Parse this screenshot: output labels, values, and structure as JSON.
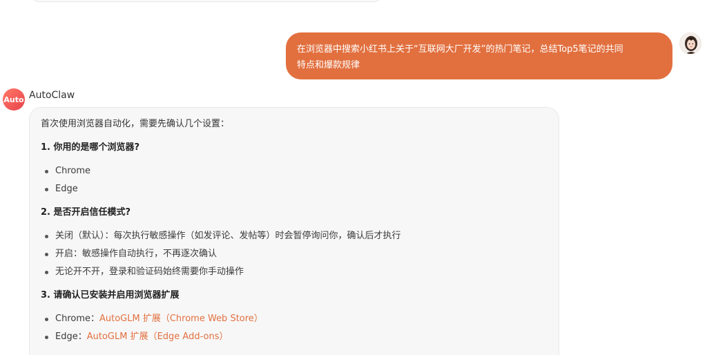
{
  "user_message": {
    "line1": "在浏览器中搜索小红书上关于“互联网大厂开发”的热门笔记，总结Top5笔记的共同",
    "line2": "特点和爆款规律"
  },
  "assistant": {
    "avatar_text": "Auto",
    "name": "AutoClaw",
    "intro": "首次使用浏览器自动化，需要先确认几个设置：",
    "q1": {
      "heading": "1. 你用的是哪个浏览器?",
      "options": [
        "Chrome",
        "Edge"
      ]
    },
    "q2": {
      "heading": "2. 是否开启信任模式?",
      "options": [
        "关闭（默认）：每次执行敏感操作（如发评论、发帖等）时会暂停询问你，确认后才执行",
        "开启：敏感操作自动执行，不再逐次确认",
        "无论开不开，登录和验证码始终需要你手动操作"
      ]
    },
    "q3": {
      "heading": "3. 请确认已安装并启用浏览器扩展",
      "chrome_label": "Chrome：",
      "chrome_link": "AutoGLM 扩展（Chrome Web Store）",
      "edge_label": "Edge：",
      "edge_link": "AutoGLM 扩展（Edge Add-ons）"
    }
  },
  "colors": {
    "accent": "#e2703f",
    "bot_avatar": "#e8424a",
    "bubble_bg": "#f7f7f7"
  }
}
